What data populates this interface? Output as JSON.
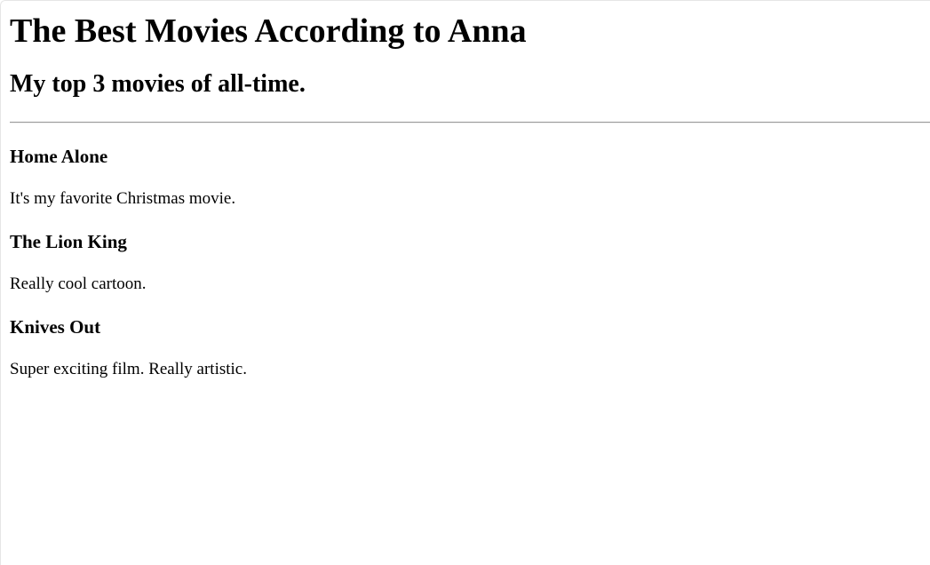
{
  "page": {
    "title": "The Best Movies According to Anna",
    "subtitle": "My top 3 movies of all-time."
  },
  "movies": [
    {
      "title": "Home Alone",
      "description": "It's my favorite Christmas movie."
    },
    {
      "title": "The Lion King",
      "description": "Really cool cartoon."
    },
    {
      "title": "Knives Out",
      "description": "Super exciting film. Really artistic."
    }
  ]
}
